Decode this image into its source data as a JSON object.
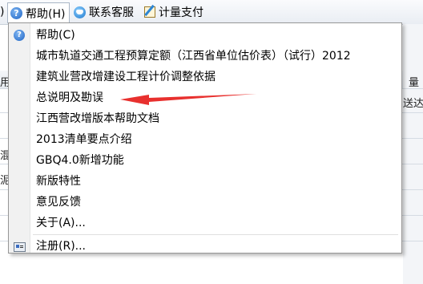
{
  "toolbar": {
    "left_fragment": ")",
    "help_menu": "帮助(H)",
    "contact": "联系客服",
    "payment": "计量支付"
  },
  "background": {
    "fragment_1": "用",
    "fragment_2": "量",
    "fragment_3": "送达立",
    "fragment_4": "混",
    "fragment_5": "泥"
  },
  "menu": {
    "items": [
      {
        "label": "帮助(C)",
        "icon": "help-icon"
      },
      {
        "label": "城市轨道交通工程预算定额（江西省单位估价表）（试行）2012",
        "icon": ""
      },
      {
        "label": "建筑业营改增建设工程计价调整依据",
        "icon": ""
      },
      {
        "label": "总说明及勘误",
        "icon": ""
      },
      {
        "label": "江西营改增版本帮助文档",
        "icon": ""
      },
      {
        "label": "2013清单要点介绍",
        "icon": ""
      },
      {
        "label": "GBQ4.0新增功能",
        "icon": ""
      },
      {
        "label": "新版特性",
        "icon": ""
      },
      {
        "label": "意见反馈",
        "icon": ""
      },
      {
        "label": "关于(A)...",
        "icon": ""
      },
      {
        "label": "注册(R)...",
        "icon": "register-icon"
      }
    ]
  },
  "colors": {
    "annotation_arrow": "#e8302e",
    "menu_gutter": "#f1f1f1",
    "help_icon": "#1d63c4"
  }
}
